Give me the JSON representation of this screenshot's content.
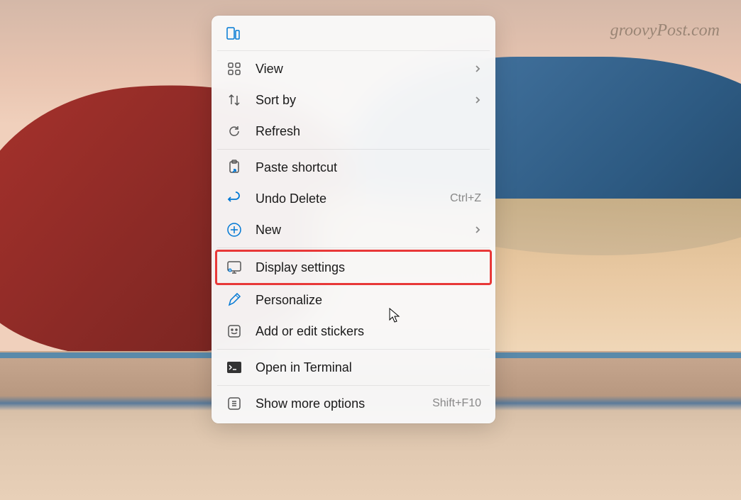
{
  "watermark": "groovyPost.com",
  "menu": {
    "view": {
      "label": "View",
      "has_submenu": true
    },
    "sort_by": {
      "label": "Sort by",
      "has_submenu": true
    },
    "refresh": {
      "label": "Refresh"
    },
    "paste_shortcut": {
      "label": "Paste shortcut"
    },
    "undo_delete": {
      "label": "Undo Delete",
      "shortcut": "Ctrl+Z"
    },
    "new": {
      "label": "New",
      "has_submenu": true
    },
    "display_settings": {
      "label": "Display settings",
      "highlighted": true
    },
    "personalize": {
      "label": "Personalize"
    },
    "add_stickers": {
      "label": "Add or edit stickers"
    },
    "open_terminal": {
      "label": "Open in Terminal"
    },
    "show_more": {
      "label": "Show more options",
      "shortcut": "Shift+F10"
    }
  }
}
